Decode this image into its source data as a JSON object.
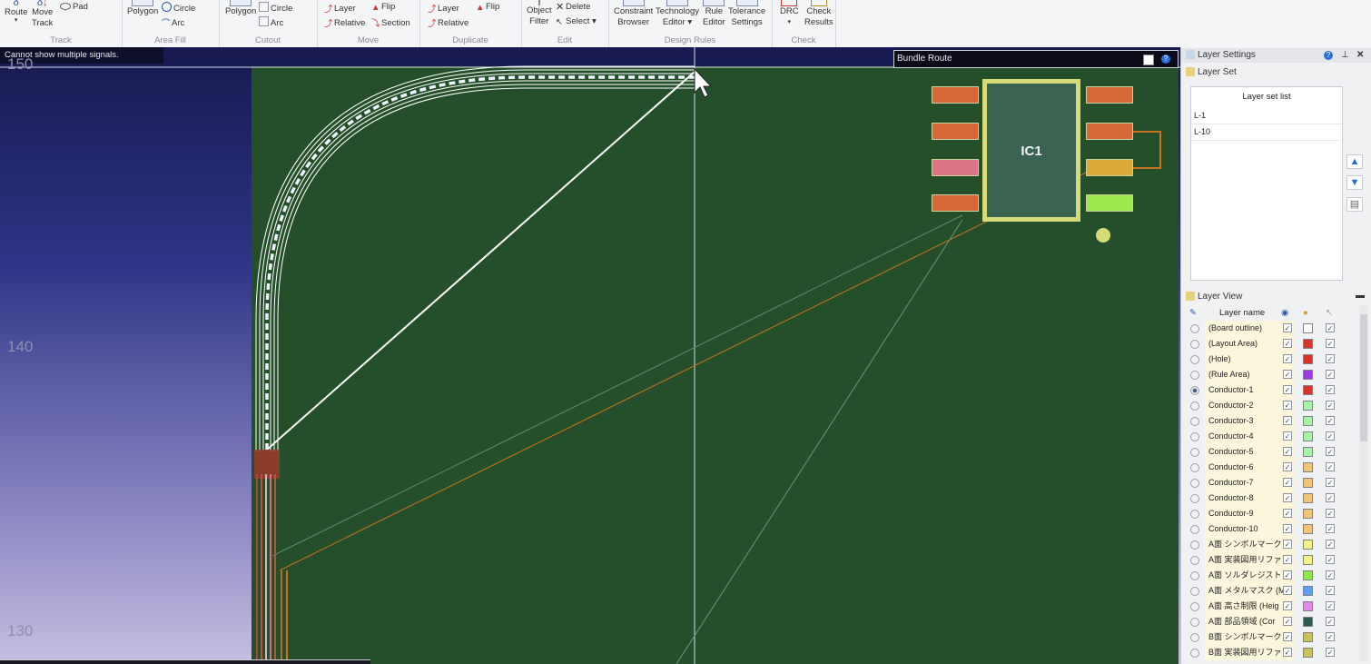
{
  "ribbon": {
    "groups": [
      {
        "name": "Track",
        "items": [
          "Route",
          "Move Track",
          "Pad"
        ]
      },
      {
        "name": "Area Fill",
        "items": [
          "Polygon",
          "Circle",
          "Arc"
        ]
      },
      {
        "name": "Cutout",
        "items": [
          "Polygon",
          "Circle",
          "Arc"
        ]
      },
      {
        "name": "Move",
        "items": [
          "Layer",
          "Relative",
          "Flip",
          "Section"
        ]
      },
      {
        "name": "Duplicate",
        "items": [
          "Layer",
          "Relative",
          "Flip"
        ]
      },
      {
        "name": "Edit",
        "items": [
          "Object Filter",
          "Delete",
          "Select"
        ]
      },
      {
        "name": "Design Rules",
        "items": [
          "Constraint Browser",
          "Technology Editor",
          "Rule Editor",
          "Tolerance Settings"
        ]
      },
      {
        "name": "Check",
        "items": [
          "DRC",
          "Check Results"
        ]
      }
    ],
    "track": {
      "route": "Route",
      "move": "Move",
      "track": "Track",
      "pad": "Pad",
      "label": "Track"
    },
    "areafill": {
      "polygon": "Polygon",
      "circle": "Circle",
      "arc": "Arc",
      "label": "Area Fill"
    },
    "cutout": {
      "polygon": "Polygon",
      "circle": "Circle",
      "arc": "Arc",
      "label": "Cutout"
    },
    "move": {
      "layer": "Layer",
      "relative": "Relative",
      "flip": "Flip",
      "section": "Section",
      "label": "Move"
    },
    "duplicate": {
      "layer": "Layer",
      "relative": "Relative",
      "flip": "Flip",
      "label": "Duplicate"
    },
    "edit": {
      "object": "Object",
      "filter": "Filter",
      "delete": "Delete",
      "select": "Select",
      "label": "Edit"
    },
    "rules": {
      "constraint": "Constraint",
      "browser": "Browser",
      "technology": "Technology",
      "editor": "Editor",
      "rule": "Rule",
      "rule_editor": "Editor",
      "tolerance": "Tolerance",
      "settings": "Settings",
      "label": "Design Rules"
    },
    "check": {
      "drc": "DRC",
      "check": "Check",
      "results": "Results",
      "label": "Check"
    }
  },
  "canvas": {
    "status_message": "Cannot show multiple signals.",
    "y_ticks": [
      "150",
      "140",
      "130"
    ],
    "bundle_route_title": "Bundle Route",
    "component_label": "IC1",
    "colors": {
      "board": "#244f2a",
      "trace": "#ffffff",
      "ratsnest_orange": "#c7741f",
      "pad_orange": "#d7683a",
      "pad_pink": "#d97585",
      "pad_yellow": "#d9a93a",
      "pad_green": "#9ee84f",
      "ic_outline": "#d6db77"
    }
  },
  "panel": {
    "title": "Layer Settings",
    "layer_set_title": "Layer Set",
    "layer_set_list_header": "Layer set list",
    "layer_sets": [
      "L-1",
      "L-10"
    ],
    "layer_view_title": "Layer View",
    "column_layer_name": "Layer name",
    "layers": [
      {
        "name": "(Board outline)",
        "color": "#ffffff",
        "active": false
      },
      {
        "name": "(Layout Area)",
        "color": "#d9342b",
        "active": false
      },
      {
        "name": "(Hole)",
        "color": "#d9342b",
        "active": false
      },
      {
        "name": "(Rule Area)",
        "color": "#9b3ee0",
        "active": false
      },
      {
        "name": "Conductor-1",
        "color": "#d9342b",
        "active": true
      },
      {
        "name": "Conductor-2",
        "color": "#a9f2a9",
        "active": false
      },
      {
        "name": "Conductor-3",
        "color": "#a9f2a9",
        "active": false
      },
      {
        "name": "Conductor-4",
        "color": "#a9f2a9",
        "active": false
      },
      {
        "name": "Conductor-5",
        "color": "#a9f2a9",
        "active": false
      },
      {
        "name": "Conductor-6",
        "color": "#f2c47a",
        "active": false
      },
      {
        "name": "Conductor-7",
        "color": "#f2c47a",
        "active": false
      },
      {
        "name": "Conductor-8",
        "color": "#f2c47a",
        "active": false
      },
      {
        "name": "Conductor-9",
        "color": "#f2c47a",
        "active": false
      },
      {
        "name": "Conductor-10",
        "color": "#f2c47a",
        "active": false
      },
      {
        "name": "A面 シンボルマーク (",
        "color": "#f4f28a",
        "active": false
      },
      {
        "name": "A面 実装図用リファレ",
        "color": "#f4f28a",
        "active": false
      },
      {
        "name": "A面 ソルダレジスト (",
        "color": "#8fe84a",
        "active": false
      },
      {
        "name": "A面 メタルマスク (Me",
        "color": "#5f9ef2",
        "active": false
      },
      {
        "name": "A面 高さ制限 (Heig",
        "color": "#e28ae8",
        "active": false
      },
      {
        "name": "A面 部品領域 (Cor",
        "color": "#2e5a52",
        "active": false
      },
      {
        "name": "B面 シンボルマーク (",
        "color": "#c8c25a",
        "active": false
      },
      {
        "name": "B面 実装図用リファレ",
        "color": "#c8c25a",
        "active": false
      }
    ]
  }
}
